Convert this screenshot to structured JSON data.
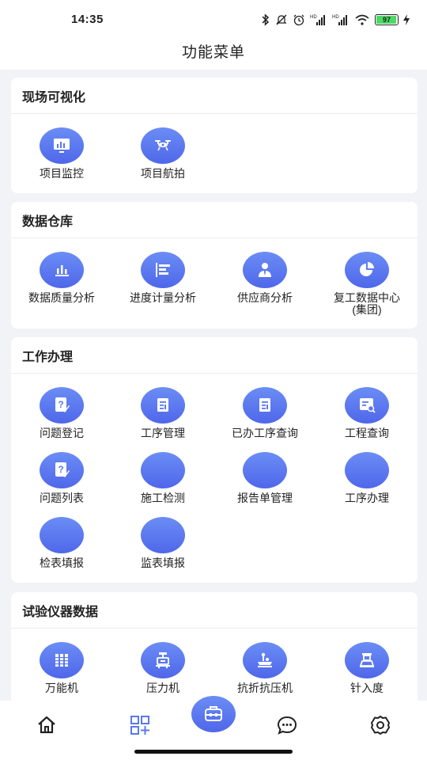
{
  "status_bar": {
    "time": "14:35",
    "battery": "97",
    "battery_level": 0.97,
    "icons": [
      "bluetooth-icon",
      "mute-icon",
      "alarm-icon",
      "signal-hd-icon",
      "signal-hd-icon",
      "wifi-icon",
      "battery-icon",
      "charging-icon"
    ]
  },
  "header": {
    "title": "功能菜单"
  },
  "sections": [
    {
      "title": "现场可视化",
      "items": [
        {
          "label": "项目监控",
          "icon": "monitor-chart-icon"
        },
        {
          "label": "项目航拍",
          "icon": "drone-icon"
        }
      ]
    },
    {
      "title": "数据仓库",
      "items": [
        {
          "label": "数据质量分析",
          "icon": "bar-chart-icon"
        },
        {
          "label": "进度计量分析",
          "icon": "gantt-icon"
        },
        {
          "label": "供应商分析",
          "icon": "user-tie-icon"
        },
        {
          "label": "复工数据中心",
          "label2": "(集团)",
          "icon": "pie-chart-icon"
        }
      ]
    },
    {
      "title": "工作办理",
      "items": [
        {
          "label": "问题登记",
          "icon": "question-doc-icon"
        },
        {
          "label": "工序管理",
          "icon": "document-icon"
        },
        {
          "label": "已办工序查询",
          "icon": "document-icon"
        },
        {
          "label": "工程查询",
          "icon": "search-doc-icon"
        },
        {
          "label": "问题列表",
          "icon": "question-doc-icon"
        },
        {
          "label": "施工检测",
          "icon": ""
        },
        {
          "label": "报告单管理",
          "icon": ""
        },
        {
          "label": "工序办理",
          "icon": ""
        },
        {
          "label": "检表填报",
          "icon": ""
        },
        {
          "label": "监表填报",
          "icon": ""
        }
      ]
    },
    {
      "title": "试验仪器数据",
      "items": [
        {
          "label": "万能机",
          "icon": "universal-machine-icon"
        },
        {
          "label": "压力机",
          "icon": "press-icon"
        },
        {
          "label": "抗折抗压机",
          "icon": "flexural-machine-icon"
        },
        {
          "label": "针入度",
          "icon": "penetrometer-icon"
        }
      ]
    }
  ],
  "tabbar": {
    "items": [
      {
        "icon": "home-icon"
      },
      {
        "icon": "apps-grid-icon",
        "active": true
      },
      {
        "icon": "toolbox-icon"
      },
      {
        "icon": "chat-icon"
      },
      {
        "icon": "settings-icon"
      }
    ],
    "active_color": "#5a78ef"
  },
  "colors": {
    "accent": "#5a78ef",
    "background": "#f2f3f7"
  }
}
